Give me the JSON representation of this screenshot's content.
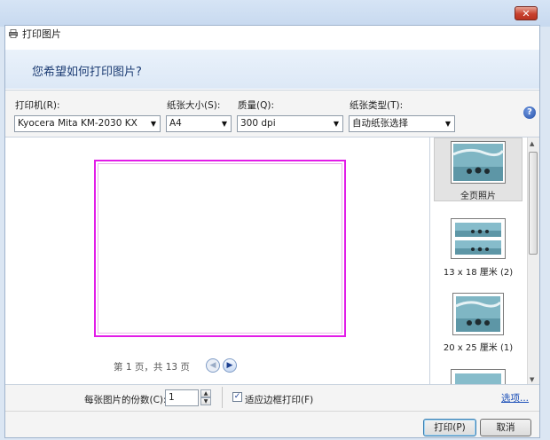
{
  "window": {
    "title": "打印图片",
    "question": "您希望如何打印图片?",
    "close_label": "✕"
  },
  "toolbar": {
    "printer_label": "打印机(R):",
    "printer_value": "Kyocera Mita KM-2030 KX",
    "paper_size_label": "纸张大小(S):",
    "paper_size_value": "A4",
    "quality_label": "质量(Q):",
    "quality_value": "300 dpi",
    "paper_type_label": "纸张类型(T):",
    "paper_type_value": "自动纸张选择",
    "help_label": "?"
  },
  "preview": {
    "page_status": "第 1 页，共 13 页"
  },
  "layouts": [
    {
      "label": "全页照片",
      "selected": true
    },
    {
      "label": "13 x 18 厘米 (2)",
      "selected": false
    },
    {
      "label": "20 x 25 厘米 (1)",
      "selected": false
    }
  ],
  "options": {
    "copies_label": "每张图片的份数(C):",
    "copies_value": "1",
    "fit_label": "适应边框打印(F)",
    "fit_checked": true,
    "options_link": "选项..."
  },
  "buttons": {
    "print": "打印(P)",
    "cancel": "取消"
  },
  "colors": {
    "page_border": "#e21ce8",
    "header_text": "#1d3d74",
    "link": "#1b4fb8"
  },
  "icons": [
    "printer-icon",
    "close-icon",
    "help-icon",
    "dropdown-arrow-icon",
    "prev-page-icon",
    "next-page-icon",
    "checkbox-check-icon"
  ]
}
